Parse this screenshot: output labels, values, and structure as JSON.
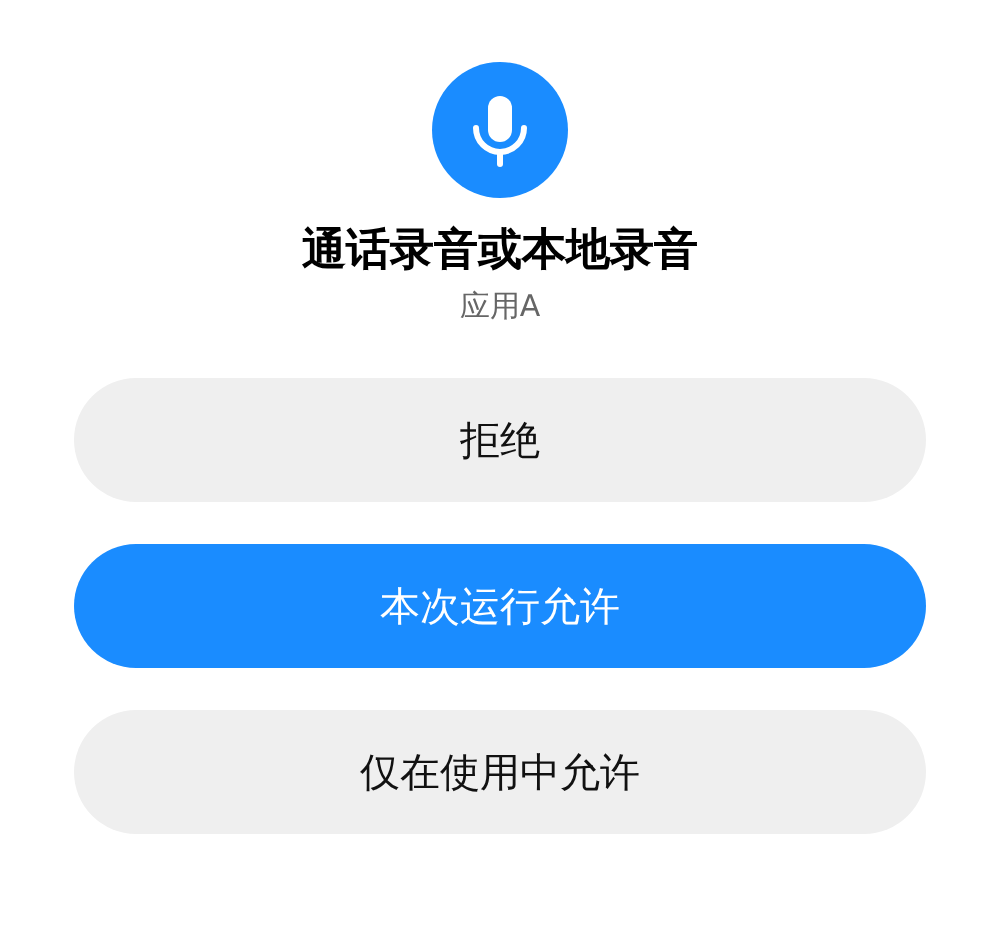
{
  "title": "通话录音或本地录音",
  "app_name": "应用A",
  "buttons": [
    {
      "label": "拒绝",
      "kind": "secondary"
    },
    {
      "label": "本次运行允许",
      "kind": "primary"
    },
    {
      "label": "仅在使用中允许",
      "kind": "secondary"
    }
  ]
}
